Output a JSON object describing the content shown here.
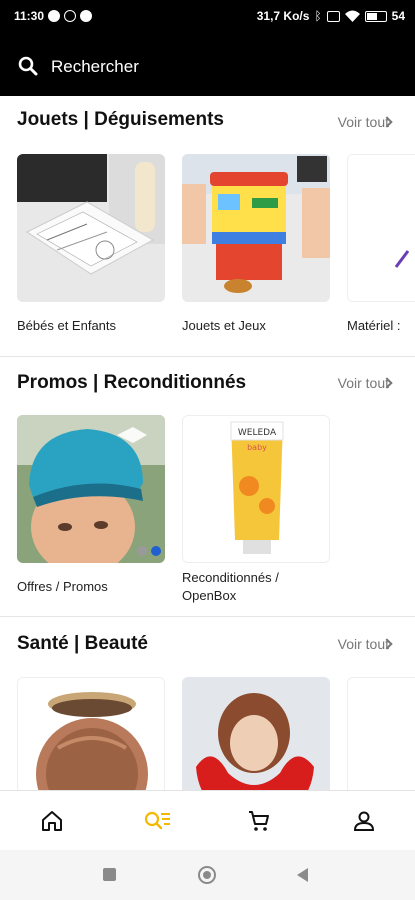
{
  "status": {
    "time": "11:30",
    "net_speed": "31,7 Ko/s",
    "battery": "54"
  },
  "search": {
    "label": "Rechercher"
  },
  "sections": [
    {
      "title": "Jouets | Déguisements",
      "see_all": "Voir tout",
      "cards": [
        {
          "label": "Bébés et Enfants"
        },
        {
          "label": "Jouets et Jeux"
        },
        {
          "label": "Matériel :"
        }
      ]
    },
    {
      "title": "Promos | Reconditionnés",
      "see_all": "Voir tout",
      "cards": [
        {
          "label": "Offres / Promos"
        },
        {
          "label_line1": "Reconditionnés /",
          "label_line2": "OpenBox",
          "brand": "WELEDA",
          "brand_sub": "baby"
        }
      ]
    },
    {
      "title": "Santé | Beauté",
      "see_all": "Voir tout",
      "cards": []
    }
  ],
  "bottom_nav": {
    "items": [
      "home-icon",
      "search-list-icon",
      "cart-icon",
      "account-icon"
    ],
    "active": "search-list-icon",
    "active_color": "#f5b800"
  }
}
